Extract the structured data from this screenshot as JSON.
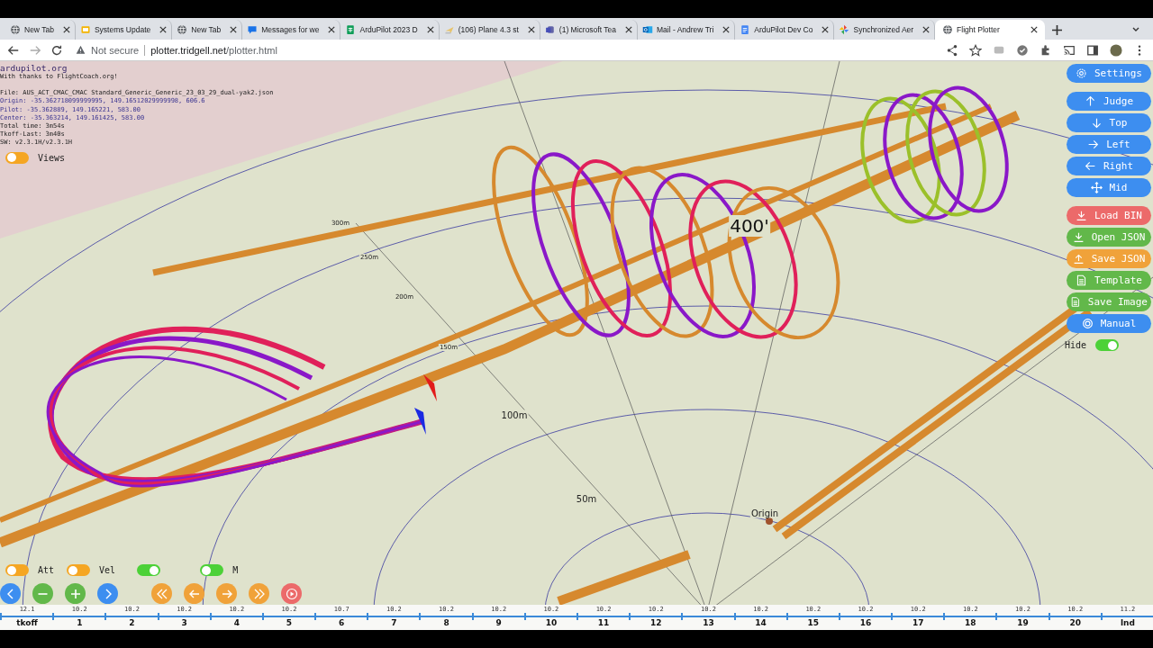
{
  "browser": {
    "tabs": [
      {
        "title": "New Tab",
        "selected": false
      },
      {
        "title": "Systems Update",
        "selected": false
      },
      {
        "title": "New Tab",
        "selected": false
      },
      {
        "title": "Messages for we",
        "selected": false
      },
      {
        "title": "ArduPilot 2023 D",
        "selected": false
      },
      {
        "title": "(106) Plane 4.3 st",
        "selected": false
      },
      {
        "title": "(1) Microsoft Tea",
        "selected": false
      },
      {
        "title": "Mail - Andrew Tri",
        "selected": false
      },
      {
        "title": "ArduPilot Dev Co",
        "selected": false
      },
      {
        "title": "Synchronized Aer",
        "selected": false
      },
      {
        "title": "Flight Plotter",
        "selected": true
      }
    ],
    "security": "Not secure",
    "url_host": "plotter.tridgell.net",
    "url_path": "/plotter.html"
  },
  "info": {
    "lines": [
      {
        "kind": "title",
        "text": "ardupilot.org"
      },
      {
        "kind": "plain",
        "text": "With thanks to FlightCoach.org!"
      },
      {
        "kind": "gap"
      },
      {
        "kind": "plain",
        "text": "File: AUS_ACT_CMAC_CMAC Standard_Generic_Generic_23_03_29_dual-yak2.json"
      },
      {
        "kind": "coord",
        "text": "Origin: -35.362718099999995, 149.16512029999998, 606.6"
      },
      {
        "kind": "coord",
        "text": "Pilot: -35.362889, 149.165221, 583.00"
      },
      {
        "kind": "coord",
        "text": "Center: -35.363214, 149.161425, 583.00"
      },
      {
        "kind": "plain",
        "text": "Total time: 3m54s"
      },
      {
        "kind": "plain",
        "text": "Tkoff-Last: 3m40s"
      },
      {
        "kind": "plain",
        "text": "SW: v2.3.1H/v2.3.1H"
      }
    ],
    "views_toggle": {
      "label": "Views",
      "on": false,
      "color": "#f5a623"
    }
  },
  "scene_labels": [
    "400'",
    "300m",
    "250m",
    "200m",
    "150m",
    "100m",
    "50m",
    "Origin"
  ],
  "side_buttons": [
    {
      "label": "Settings",
      "color": "#3d8ef0"
    },
    {
      "label": "Judge",
      "color": "#3d8ef0"
    },
    {
      "label": "Top",
      "color": "#3d8ef0"
    },
    {
      "label": "Left",
      "color": "#3d8ef0"
    },
    {
      "label": "Right",
      "color": "#3d8ef0"
    },
    {
      "label": "Mid",
      "color": "#3d8ef0"
    },
    {
      "label": "Load BIN",
      "color": "#ec6a6a"
    },
    {
      "label": "Open JSON",
      "color": "#62b84a"
    },
    {
      "label": "Save JSON",
      "color": "#f0a23a"
    },
    {
      "label": "Template",
      "color": "#62b84a"
    },
    {
      "label": "Save Image",
      "color": "#62b84a"
    },
    {
      "label": "Manual",
      "color": "#3d8ef0"
    }
  ],
  "hide_toggle": {
    "label": "Hide",
    "on": true,
    "color": "#4cd137"
  },
  "bottom_toggles": [
    {
      "label": "Att",
      "on": false,
      "color": "#f5a623"
    },
    {
      "label": "Vel",
      "on": false,
      "color": "#f5a623"
    },
    {
      "on": true,
      "color": "#4cd137"
    },
    {
      "label": "M",
      "on": false,
      "color": "#4cd137"
    }
  ],
  "playback_buttons": [
    {
      "color": "#3d8ef0"
    },
    {
      "color": "#62b84a"
    },
    {
      "color": "#62b84a"
    },
    {
      "color": "#3d8ef0"
    },
    {
      "color": "#f0a23a"
    },
    {
      "color": "#f0a23a"
    },
    {
      "color": "#f0a23a"
    },
    {
      "color": "#f0a23a"
    },
    {
      "color": "#ec6a6a"
    }
  ],
  "timeline": [
    {
      "value": "12.1",
      "label": "tkoff"
    },
    {
      "value": "10.2",
      "label": "1"
    },
    {
      "value": "10.2",
      "label": "2"
    },
    {
      "value": "10.2",
      "label": "3"
    },
    {
      "value": "10.2",
      "label": "4"
    },
    {
      "value": "10.2",
      "label": "5"
    },
    {
      "value": "10.7",
      "label": "6"
    },
    {
      "value": "10.2",
      "label": "7"
    },
    {
      "value": "10.2",
      "label": "8"
    },
    {
      "value": "10.2",
      "label": "9"
    },
    {
      "value": "10.2",
      "label": "10"
    },
    {
      "value": "10.2",
      "label": "11"
    },
    {
      "value": "10.2",
      "label": "12"
    },
    {
      "value": "10.2",
      "label": "13"
    },
    {
      "value": "10.2",
      "label": "14"
    },
    {
      "value": "10.2",
      "label": "15"
    },
    {
      "value": "10.2",
      "label": "16"
    },
    {
      "value": "10.2",
      "label": "17"
    },
    {
      "value": "10.2",
      "label": "18"
    },
    {
      "value": "10.2",
      "label": "19"
    },
    {
      "value": "10.2",
      "label": "20"
    },
    {
      "value": "11.2",
      "label": "lnd"
    }
  ]
}
